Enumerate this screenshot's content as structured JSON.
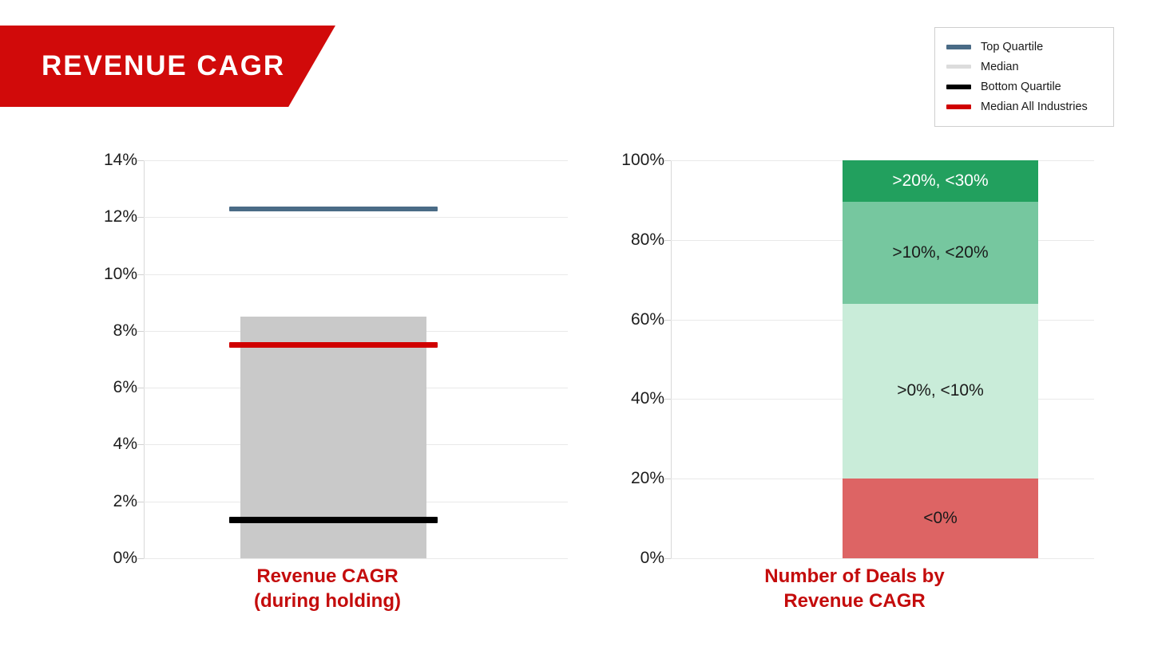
{
  "banner": {
    "title": "REVENUE CAGR",
    "color": "#d10a0a"
  },
  "legend": {
    "items": [
      {
        "label": "Top Quartile",
        "color": "#4a6b86"
      },
      {
        "label": "Median",
        "color": "#dcdcdc"
      },
      {
        "label": "Bottom Quartile",
        "color": "#000000"
      },
      {
        "label": "Median All Industries",
        "color": "#d00000"
      }
    ]
  },
  "chart_data": [
    {
      "type": "bar",
      "id": "revenue-cagr-quartiles",
      "title": "",
      "xlabel": "Revenue CAGR\n(during holding)",
      "xlabel_lines": [
        "Revenue CAGR",
        "(during holding)"
      ],
      "ylabel": "",
      "ylim": [
        0,
        14
      ],
      "yticks": [
        0,
        2,
        4,
        6,
        8,
        10,
        12,
        14
      ],
      "ytick_labels": [
        "0%",
        "2%",
        "4%",
        "6%",
        "8%",
        "10%",
        "12%",
        "14%"
      ],
      "grid": true,
      "categories": [
        "Revenue CAGR (during holding)"
      ],
      "bars": [
        {
          "name": "Median (interquartile band)",
          "top": 8.5,
          "bottom": 0,
          "color": "#c9c9c9"
        }
      ],
      "markers": [
        {
          "name": "Top Quartile",
          "value": 12.3,
          "color": "#4a6b86",
          "thickness": 6
        },
        {
          "name": "Median All Industries",
          "value": 7.5,
          "color": "#d00000",
          "thickness": 7
        },
        {
          "name": "Bottom Quartile",
          "value": 1.35,
          "color": "#000000",
          "thickness": 8
        }
      ]
    },
    {
      "type": "bar",
      "id": "number-of-deals-by-revenue-cagr",
      "subtype": "stacked-100",
      "title": "",
      "xlabel": "Number of Deals by\nRevenue CAGR",
      "xlabel_lines": [
        "Number of Deals by",
        "Revenue CAGR"
      ],
      "ylabel": "",
      "ylim": [
        0,
        100
      ],
      "yticks": [
        0,
        20,
        40,
        60,
        80,
        100
      ],
      "ytick_labels": [
        "0%",
        "20%",
        "40%",
        "60%",
        "80%",
        "100%"
      ],
      "grid": true,
      "categories": [
        "Number of Deals by Revenue CAGR"
      ],
      "stack_order": "bottom-to-top",
      "segments": [
        {
          "label": "<0%",
          "value": 20.0,
          "cum_start": 0.0,
          "cum_end": 20.0,
          "color": "#dd6464",
          "text_color": "#1a1a1a"
        },
        {
          "label": ">0%, <10%",
          "value": 44.0,
          "cum_start": 20.0,
          "cum_end": 64.0,
          "color": "#c9ecd9",
          "text_color": "#1a1a1a"
        },
        {
          "label": ">10%, <20%",
          "value": 25.6,
          "cum_start": 64.0,
          "cum_end": 89.6,
          "color": "#76c79f",
          "text_color": "#1a1a1a"
        },
        {
          "label": ">20%, <30%",
          "value": 10.4,
          "cum_start": 89.6,
          "cum_end": 100.0,
          "color": "#22a05e",
          "text_color": "#ffffff"
        }
      ]
    }
  ]
}
